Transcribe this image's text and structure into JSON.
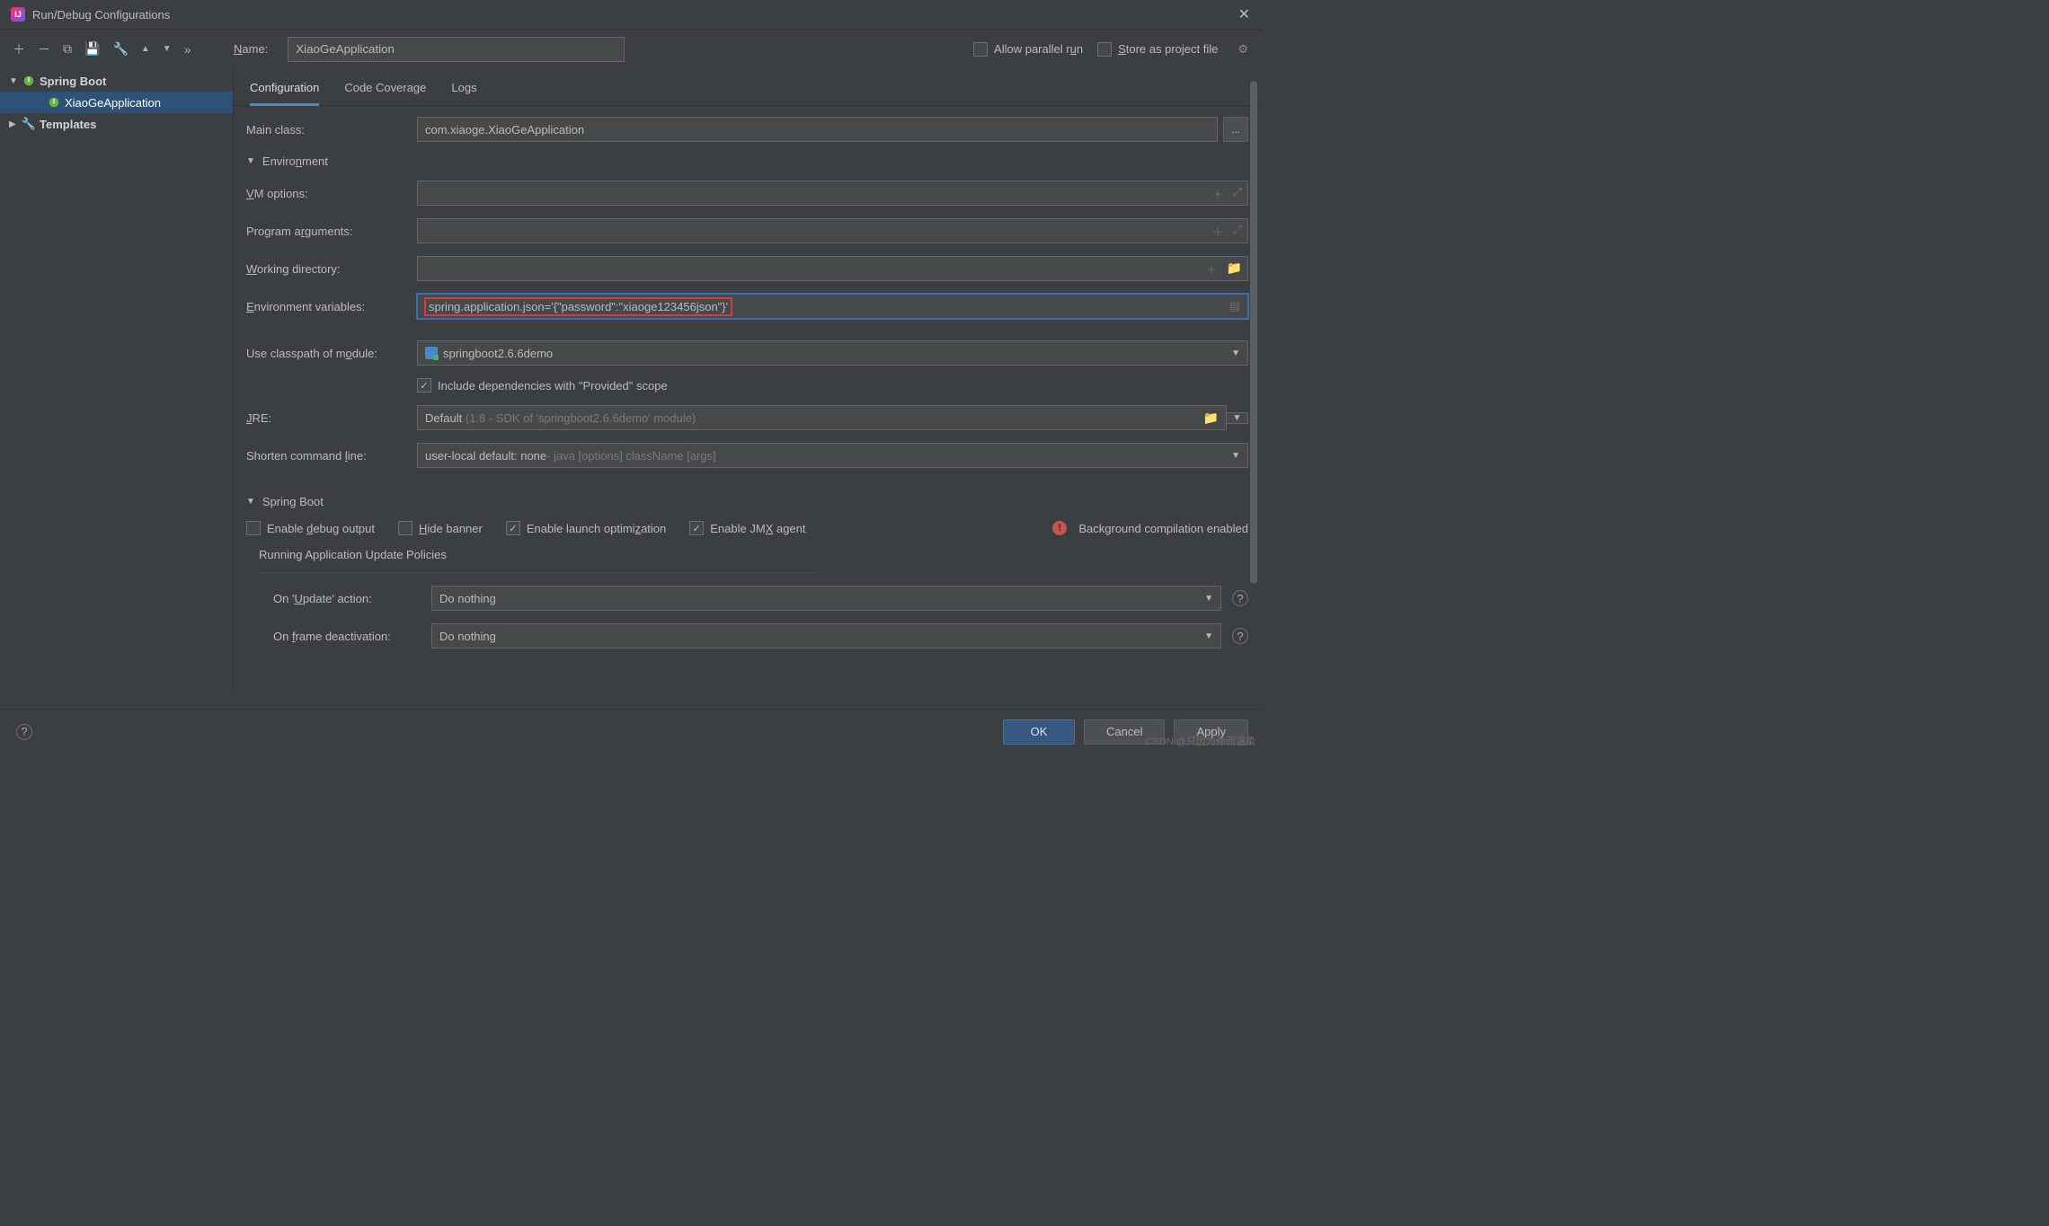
{
  "window": {
    "title": "Run/Debug Configurations"
  },
  "toolbar": {
    "name_label": "Name:",
    "name_value": "XiaoGeApplication",
    "allow_parallel": "Allow parallel run",
    "store_as_template": "Store as project file"
  },
  "sidebar": {
    "spring_boot": "Spring Boot",
    "app_item": "XiaoGeApplication",
    "templates": "Templates"
  },
  "tabs": {
    "configuration": "Configuration",
    "code_coverage": "Code Coverage",
    "logs": "Logs"
  },
  "form": {
    "main_class_lbl": "Main class:",
    "main_class_val": "com.xiaoge.XiaoGeApplication",
    "browse_btn": "...",
    "env_section": "Environment",
    "vm_options_lbl": "VM options:",
    "vm_options_val": "",
    "prog_args_lbl": "Program arguments:",
    "prog_args_val": "",
    "working_dir_lbl": "Working directory:",
    "working_dir_val": "",
    "env_vars_lbl": "Environment variables:",
    "env_vars_val": "spring.application.json='{\"password\":\"xiaoge123456json\"}'",
    "classpath_lbl": "Use classpath of module:",
    "classpath_val": "springboot2.6.6demo",
    "include_provided": "Include dependencies with \"Provided\" scope",
    "jre_lbl": "JRE:",
    "jre_val": "Default",
    "jre_hint": "(1.8 - SDK of 'springboot2.6.6demo' module)",
    "shorten_lbl": "Shorten command line:",
    "shorten_val": "user-local default: none",
    "shorten_hint": " - java [options] className [args]",
    "sb_section": "Spring Boot",
    "enable_debug": "Enable debug output",
    "hide_banner": "Hide banner",
    "enable_launch_opt": "Enable launch optimization",
    "enable_jmx": "Enable JMX agent",
    "bg_compilation": "Background compilation enabled",
    "policies_hdr": "Running Application Update Policies",
    "on_update_lbl": "On 'Update' action:",
    "on_update_val": "Do nothing",
    "on_frame_lbl": "On frame deactivation:",
    "on_frame_val": "Do nothing"
  },
  "footer": {
    "ok": "OK",
    "cancel": "Cancel",
    "apply": "Apply"
  },
  "watermark": "CSDN @只因为你而温柔"
}
